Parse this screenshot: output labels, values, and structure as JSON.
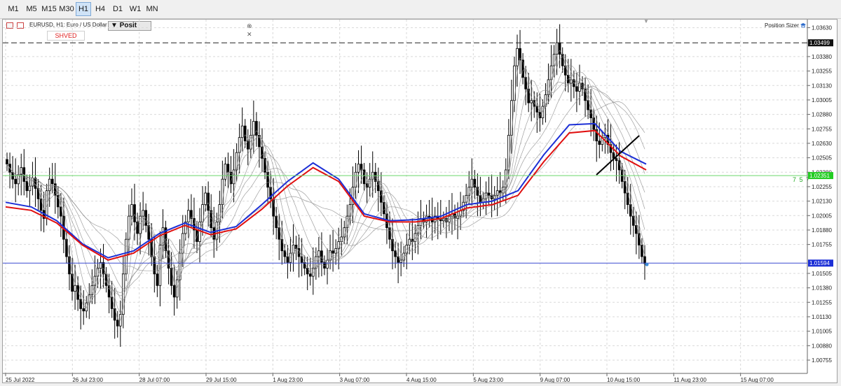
{
  "timeframes": [
    {
      "label": "M1",
      "active": false
    },
    {
      "label": "M5",
      "active": false
    },
    {
      "label": "M15",
      "active": false
    },
    {
      "label": "M30",
      "active": false
    },
    {
      "label": "H1",
      "active": true
    },
    {
      "label": "H4",
      "active": false
    },
    {
      "label": "D1",
      "active": false
    },
    {
      "label": "W1",
      "active": false
    },
    {
      "label": "MN",
      "active": false
    }
  ],
  "chart_header": {
    "symbol_text": "EURUSD, H1: Euro / US Dollar",
    "shved_label": "SHVED",
    "position_button": "▼ Posit",
    "close_glyph": "⊗ ✕",
    "position_sizer_label": "Position Sizer",
    "right_label": "7 5 7"
  },
  "colors": {
    "bullish": "#000000",
    "bearish": "#000000",
    "blue_ma": "#1c2fd6",
    "red_ma": "#e01010",
    "green_line": "#6cd66c",
    "blue_line": "#3a4ad0",
    "dashed_line": "#222222",
    "green_tag": "#22cc22",
    "blue_tag": "#1c2fd6",
    "black_tag": "#111111"
  },
  "chart_data": {
    "type": "candlestick",
    "symbol": "EURUSD",
    "timeframe": "H1",
    "y_range": [
      1.0064,
      1.037
    ],
    "y_ticks": [
      "1.03630",
      "1.03380",
      "1.03255",
      "1.03130",
      "1.03005",
      "1.02880",
      "1.02755",
      "1.02630",
      "1.02505",
      "1.02380",
      "1.02255",
      "1.02130",
      "1.02005",
      "1.01880",
      "1.01755",
      "1.01505",
      "1.01380",
      "1.01255",
      "1.01130",
      "1.01005",
      "1.00880",
      "1.00755"
    ],
    "x_labels": [
      "25 Jul 2022",
      "26 Jul 23:00",
      "28 Jul 07:00",
      "29 Jul 15:00",
      "1 Aug 23:00",
      "3 Aug 07:00",
      "4 Aug 15:00",
      "5 Aug 23:00",
      "9 Aug 07:00",
      "10 Aug 15:00",
      "11 Aug 23:00",
      "15 Aug 07:00"
    ],
    "horizontal_lines": [
      {
        "name": "resistance-dashed",
        "price": 1.03499,
        "label": "1.03499",
        "style": "dashed"
      },
      {
        "name": "green-level",
        "price": 1.02351,
        "label": "1.02351",
        "style": "solid"
      },
      {
        "name": "current-price",
        "price": 1.01594,
        "label": "1.01594",
        "style": "solid"
      }
    ],
    "closes": [
      1.0245,
      1.0238,
      1.0232,
      1.0228,
      1.0236,
      1.0242,
      1.023,
      1.0222,
      1.0226,
      1.0233,
      1.0224,
      1.0215,
      1.0205,
      1.0198,
      1.0222,
      1.0232,
      1.0228,
      1.0218,
      1.0208,
      1.02,
      1.018,
      1.0165,
      1.015,
      1.0135,
      1.014,
      1.0128,
      1.012,
      1.0118,
      1.0125,
      1.0132,
      1.014,
      1.0148,
      1.0155,
      1.016,
      1.015,
      1.014,
      1.013,
      1.012,
      1.011,
      1.0105,
      1.0115,
      1.015,
      1.018,
      1.02,
      1.021,
      1.0195,
      1.0185,
      1.02,
      1.0205,
      1.0192,
      1.018,
      1.0165,
      1.015,
      1.014,
      1.0175,
      1.019,
      1.017,
      1.0155,
      1.014,
      1.013,
      1.0145,
      1.0168,
      1.0185,
      1.0195,
      1.0205,
      1.0198,
      1.0188,
      1.0178,
      1.0195,
      1.021,
      1.022,
      1.0205,
      1.019,
      1.018,
      1.0195,
      1.021,
      1.0232,
      1.0245,
      1.0238,
      1.0228,
      1.024,
      1.0255,
      1.0268,
      1.0278,
      1.0265,
      1.0258,
      1.027,
      1.0282,
      1.027,
      1.026,
      1.025,
      1.0238,
      1.0225,
      1.0215,
      1.02,
      1.019,
      1.018,
      1.017,
      1.0165,
      1.016,
      1.0168,
      1.0175,
      1.0172,
      1.0165,
      1.016,
      1.0155,
      1.015,
      1.0148,
      1.0155,
      1.0165,
      1.017,
      1.016,
      1.0155,
      1.0162,
      1.017,
      1.0168,
      1.0172,
      1.0178,
      1.0182,
      1.019,
      1.02,
      1.021,
      1.0225,
      1.0238,
      1.0245,
      1.024,
      1.0228,
      1.0225,
      1.0232,
      1.0238,
      1.023,
      1.0222,
      1.0212,
      1.0202,
      1.019,
      1.018,
      1.017,
      1.0165,
      1.016,
      1.0162,
      1.0168,
      1.0175,
      1.018,
      1.0178,
      1.0185,
      1.0192,
      1.0198,
      1.0195,
      1.02,
      1.0198,
      1.0195,
      1.02,
      1.0198,
      1.0196,
      1.0198,
      1.0195,
      1.02,
      1.0202,
      1.0198,
      1.02,
      1.0205,
      1.0212,
      1.0218,
      1.0225,
      1.0232,
      1.0225,
      1.0218,
      1.0212,
      1.0215,
      1.022,
      1.0218,
      1.0215,
      1.0218,
      1.0222,
      1.022,
      1.0225,
      1.024,
      1.027,
      1.03,
      1.033,
      1.0345,
      1.0335,
      1.032,
      1.031,
      1.0298,
      1.03,
      1.0295,
      1.029,
      1.0285,
      1.0295,
      1.0305,
      1.0318,
      1.033,
      1.034,
      1.035,
      1.034,
      1.033,
      1.0322,
      1.0315,
      1.0318,
      1.0312,
      1.0308,
      1.0315,
      1.031,
      1.03,
      1.0292,
      1.0285,
      1.0275,
      1.0265,
      1.0262,
      1.0268,
      1.027,
      1.0262,
      1.0255,
      1.025,
      1.0248,
      1.024,
      1.023,
      1.022,
      1.021,
      1.02,
      1.0192,
      1.0185,
      1.0175,
      1.0165,
      1.0159
    ],
    "blue_ma": [
      1.0212,
      1.0208,
      1.0196,
      1.0176,
      1.0164,
      1.017,
      1.0185,
      1.0194,
      1.0186,
      1.0191,
      1.021,
      1.023,
      1.0246,
      1.0232,
      1.0202,
      1.0196,
      1.0197,
      1.02,
      1.021,
      1.0213,
      1.0222,
      1.0253,
      1.0279,
      1.028,
      1.0256,
      1.0245
    ],
    "red_ma": [
      1.0208,
      1.0205,
      1.0194,
      1.0175,
      1.0162,
      1.0168,
      1.0183,
      1.0192,
      1.0184,
      1.0189,
      1.0206,
      1.0226,
      1.0242,
      1.023,
      1.02,
      1.0195,
      1.0195,
      1.0198,
      1.0207,
      1.021,
      1.0218,
      1.0247,
      1.0272,
      1.0274,
      1.0252,
      1.024
    ]
  }
}
